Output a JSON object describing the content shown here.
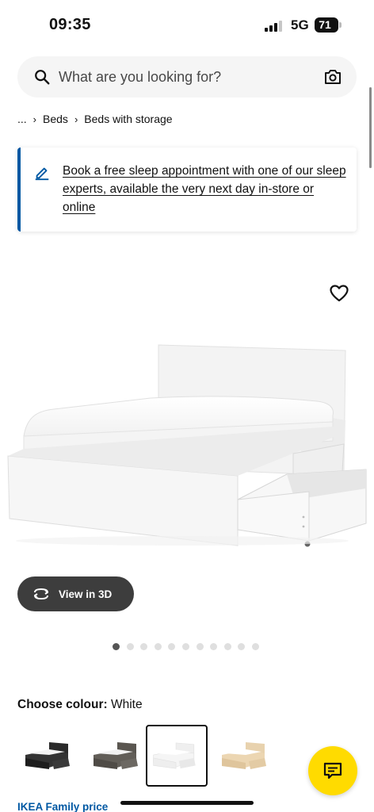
{
  "status_bar": {
    "time": "09:35",
    "network": "5G",
    "battery": "71"
  },
  "search": {
    "placeholder": "What are you looking for?"
  },
  "breadcrumb": {
    "ellipsis": "...",
    "items": [
      "Beds",
      "Beds with storage"
    ]
  },
  "banner": {
    "text": "Book a free sleep appointment with one of our sleep experts, available the very next day in-store or online",
    "accent_color": "#0058a3"
  },
  "product": {
    "view_3d_label": "View in 3D",
    "image_count": 11,
    "active_image_index": 0,
    "colour_label": "Choose colour:",
    "colour_value": "White",
    "colour_options": [
      "black",
      "grey",
      "white",
      "oak"
    ],
    "selected_colour_index": 2,
    "family_price_label": "IKEA Family price"
  },
  "icons": {
    "search": "search-icon",
    "camera": "camera-icon",
    "banner": "edit-pen-icon",
    "wishlist": "heart-icon",
    "view3d": "rotate-3d-icon",
    "chat": "chat-icon"
  },
  "colors": {
    "brand_blue": "#0058a3",
    "chat_yellow": "#ffdb00",
    "button_dark": "#3d3d3d"
  }
}
